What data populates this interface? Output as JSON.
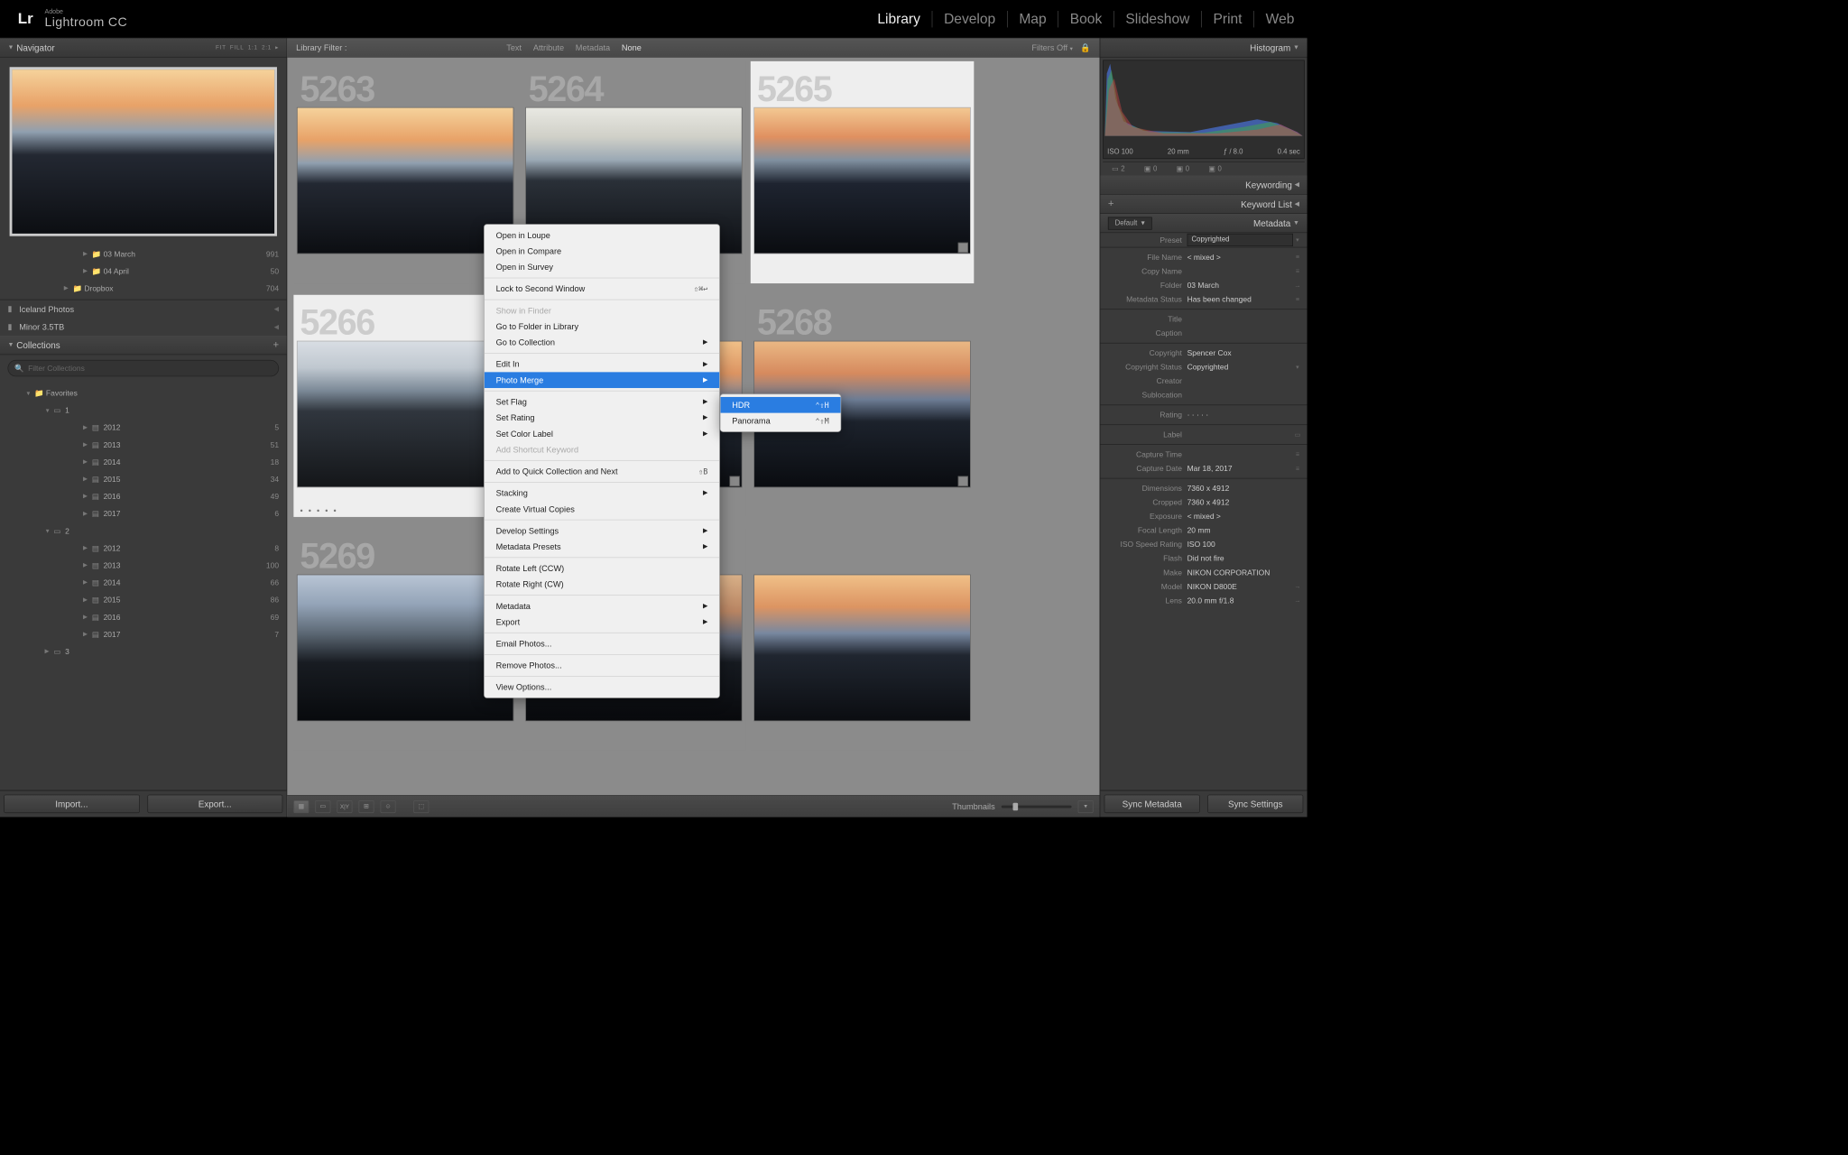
{
  "brand": {
    "adobe": "Adobe",
    "product": "Lightroom CC",
    "logo": "Lr"
  },
  "modules": [
    "Library",
    "Develop",
    "Map",
    "Book",
    "Slideshow",
    "Print",
    "Web"
  ],
  "active_module": "Library",
  "navigator": {
    "title": "Navigator",
    "opts": [
      "FIT",
      "FILL",
      "1:1",
      "2:1"
    ]
  },
  "folders": [
    {
      "depth": "d2",
      "arrow": "▶",
      "icon": "📁",
      "name": "03 March",
      "count": "991"
    },
    {
      "depth": "d2",
      "arrow": "▶",
      "icon": "📁",
      "name": "04 April",
      "count": "50"
    },
    {
      "depth": "d1",
      "arrow": "▶",
      "icon": "📁",
      "name": "Dropbox",
      "count": "704"
    }
  ],
  "storage": [
    {
      "name": "Iceland Photos"
    },
    {
      "name": "Minor 3.5TB"
    }
  ],
  "collections": {
    "title": "Collections",
    "search": "Filter Collections",
    "tree": [
      {
        "depth": "d0",
        "arrow": "▼",
        "icon": "📁",
        "name": "Favorites",
        "count": ""
      },
      {
        "depth": "dA",
        "arrow": "▼",
        "icon": "▭",
        "name": "1",
        "count": ""
      },
      {
        "depth": "dC",
        "arrow": "▶",
        "icon": "▤",
        "name": "2012",
        "count": "5"
      },
      {
        "depth": "dC",
        "arrow": "▶",
        "icon": "▤",
        "name": "2013",
        "count": "51"
      },
      {
        "depth": "dC",
        "arrow": "▶",
        "icon": "▤",
        "name": "2014",
        "count": "18"
      },
      {
        "depth": "dC",
        "arrow": "▶",
        "icon": "▤",
        "name": "2015",
        "count": "34"
      },
      {
        "depth": "dC",
        "arrow": "▶",
        "icon": "▤",
        "name": "2016",
        "count": "49"
      },
      {
        "depth": "dC",
        "arrow": "▶",
        "icon": "▤",
        "name": "2017",
        "count": "6"
      },
      {
        "depth": "dA",
        "arrow": "▼",
        "icon": "▭",
        "name": "2",
        "count": ""
      },
      {
        "depth": "dC",
        "arrow": "▶",
        "icon": "▤",
        "name": "2012",
        "count": "8"
      },
      {
        "depth": "dC",
        "arrow": "▶",
        "icon": "▤",
        "name": "2013",
        "count": "100"
      },
      {
        "depth": "dC",
        "arrow": "▶",
        "icon": "▤",
        "name": "2014",
        "count": "66"
      },
      {
        "depth": "dC",
        "arrow": "▶",
        "icon": "▤",
        "name": "2015",
        "count": "86"
      },
      {
        "depth": "dC",
        "arrow": "▶",
        "icon": "▤",
        "name": "2016",
        "count": "69"
      },
      {
        "depth": "dC",
        "arrow": "▶",
        "icon": "▤",
        "name": "2017",
        "count": "7"
      },
      {
        "depth": "dA",
        "arrow": "▶",
        "icon": "▭",
        "name": "3",
        "count": ""
      }
    ]
  },
  "buttons": {
    "import": "Import...",
    "export": "Export..."
  },
  "filterbar": {
    "title": "Library Filter :",
    "opts": [
      "Text",
      "Attribute",
      "Metadata",
      "None"
    ],
    "active": "None",
    "off": "Filters Off"
  },
  "cells": [
    {
      "num": "5263",
      "sky": "sky1",
      "sel": false
    },
    {
      "num": "5264",
      "sky": "sky2",
      "sel": false
    },
    {
      "num": "5265",
      "sky": "sky3",
      "sel": true
    },
    {
      "num": "5266",
      "sky": "sky4",
      "sel": true,
      "dots": true
    },
    {
      "num": "",
      "sky": "sky5",
      "sel": false
    },
    {
      "num": "5268",
      "sky": "sky6",
      "sel": false
    },
    {
      "num": "5269",
      "sky": "sky7",
      "sel": false
    },
    {
      "num": "",
      "sky": "sky8",
      "sel": false
    },
    {
      "num": "",
      "sky": "sky5",
      "sel": false
    }
  ],
  "toolbar": {
    "thumblabel": "Thumbnails"
  },
  "right": {
    "histogram": "Histogram",
    "histvals": {
      "iso": "ISO 100",
      "fl": "20 mm",
      "ap": "ƒ / 8.0",
      "sh": "0.4 sec"
    },
    "histbadges": {
      "a": "2",
      "b": "0",
      "c": "0",
      "d": "0"
    },
    "keywording": "Keywording",
    "keywordlist": "Keyword List",
    "metadata": "Metadata",
    "default": "Default",
    "preset": "Preset",
    "presetv": "Copyrighted",
    "rows": [
      {
        "l": "File Name",
        "v": "< mixed >",
        "e": "≡"
      },
      {
        "l": "Copy Name",
        "v": "",
        "e": "≡"
      },
      {
        "l": "Folder",
        "v": "03 March",
        "e": "→"
      },
      {
        "l": "Metadata Status",
        "v": "Has been changed",
        "e": "≡"
      }
    ],
    "rows2": [
      {
        "l": "Title",
        "v": "",
        "e": ""
      },
      {
        "l": "Caption",
        "v": "",
        "e": ""
      }
    ],
    "rows3": [
      {
        "l": "Copyright",
        "v": "Spencer Cox",
        "e": ""
      },
      {
        "l": "Copyright Status",
        "v": "Copyrighted",
        "e": "▾"
      },
      {
        "l": "Creator",
        "v": "",
        "e": ""
      },
      {
        "l": "Sublocation",
        "v": "",
        "e": ""
      }
    ],
    "rows4": [
      {
        "l": "Rating",
        "v": "·  ·  ·  ·  ·",
        "e": ""
      }
    ],
    "rows5": [
      {
        "l": "Label",
        "v": "",
        "e": "▭"
      }
    ],
    "rows6": [
      {
        "l": "Capture Time",
        "v": "",
        "e": "≡"
      },
      {
        "l": "Capture Date",
        "v": "Mar 18, 2017",
        "e": "≡"
      }
    ],
    "rows7": [
      {
        "l": "Dimensions",
        "v": "7360 x 4912",
        "e": ""
      },
      {
        "l": "Cropped",
        "v": "7360 x 4912",
        "e": ""
      },
      {
        "l": "Exposure",
        "v": "< mixed >",
        "e": ""
      },
      {
        "l": "Focal Length",
        "v": "20 mm",
        "e": ""
      },
      {
        "l": "ISO Speed Rating",
        "v": "ISO 100",
        "e": ""
      },
      {
        "l": "Flash",
        "v": "Did not fire",
        "e": ""
      },
      {
        "l": "Make",
        "v": "NIKON CORPORATION",
        "e": ""
      },
      {
        "l": "Model",
        "v": "NIKON D800E",
        "e": "→"
      },
      {
        "l": "Lens",
        "v": "20.0 mm f/1.8",
        "e": "→"
      }
    ],
    "sync": {
      "meta": "Sync Metadata",
      "set": "Sync Settings"
    }
  },
  "ctx1": [
    {
      "t": "Open in Loupe"
    },
    {
      "t": "Open in Compare"
    },
    {
      "t": "Open in Survey"
    },
    {
      "sep": true
    },
    {
      "t": "Lock to Second Window",
      "sc": "⇧⌘↩"
    },
    {
      "sep": true
    },
    {
      "t": "Show in Finder",
      "dis": true
    },
    {
      "t": "Go to Folder in Library"
    },
    {
      "t": "Go to Collection",
      "sub": true
    },
    {
      "sep": true
    },
    {
      "t": "Edit In",
      "sub": true
    },
    {
      "t": "Photo Merge",
      "sub": true,
      "hl": true
    },
    {
      "sep": true
    },
    {
      "t": "Set Flag",
      "sub": true
    },
    {
      "t": "Set Rating",
      "sub": true
    },
    {
      "t": "Set Color Label",
      "sub": true
    },
    {
      "t": "Add Shortcut Keyword",
      "dis": true
    },
    {
      "sep": true
    },
    {
      "t": "Add to Quick Collection and Next",
      "sc": "⇧B"
    },
    {
      "sep": true
    },
    {
      "t": "Stacking",
      "sub": true
    },
    {
      "t": "Create Virtual Copies"
    },
    {
      "sep": true
    },
    {
      "t": "Develop Settings",
      "sub": true
    },
    {
      "t": "Metadata Presets",
      "sub": true
    },
    {
      "sep": true
    },
    {
      "t": "Rotate Left (CCW)"
    },
    {
      "t": "Rotate Right (CW)"
    },
    {
      "sep": true
    },
    {
      "t": "Metadata",
      "sub": true
    },
    {
      "t": "Export",
      "sub": true
    },
    {
      "sep": true
    },
    {
      "t": "Email Photos..."
    },
    {
      "sep": true
    },
    {
      "t": "Remove Photos..."
    },
    {
      "sep": true
    },
    {
      "t": "View Options..."
    }
  ],
  "ctx2": [
    {
      "t": "HDR",
      "sc": "⌃⇧H",
      "hl": true
    },
    {
      "t": "Panorama",
      "sc": "⌃⇧M"
    }
  ]
}
